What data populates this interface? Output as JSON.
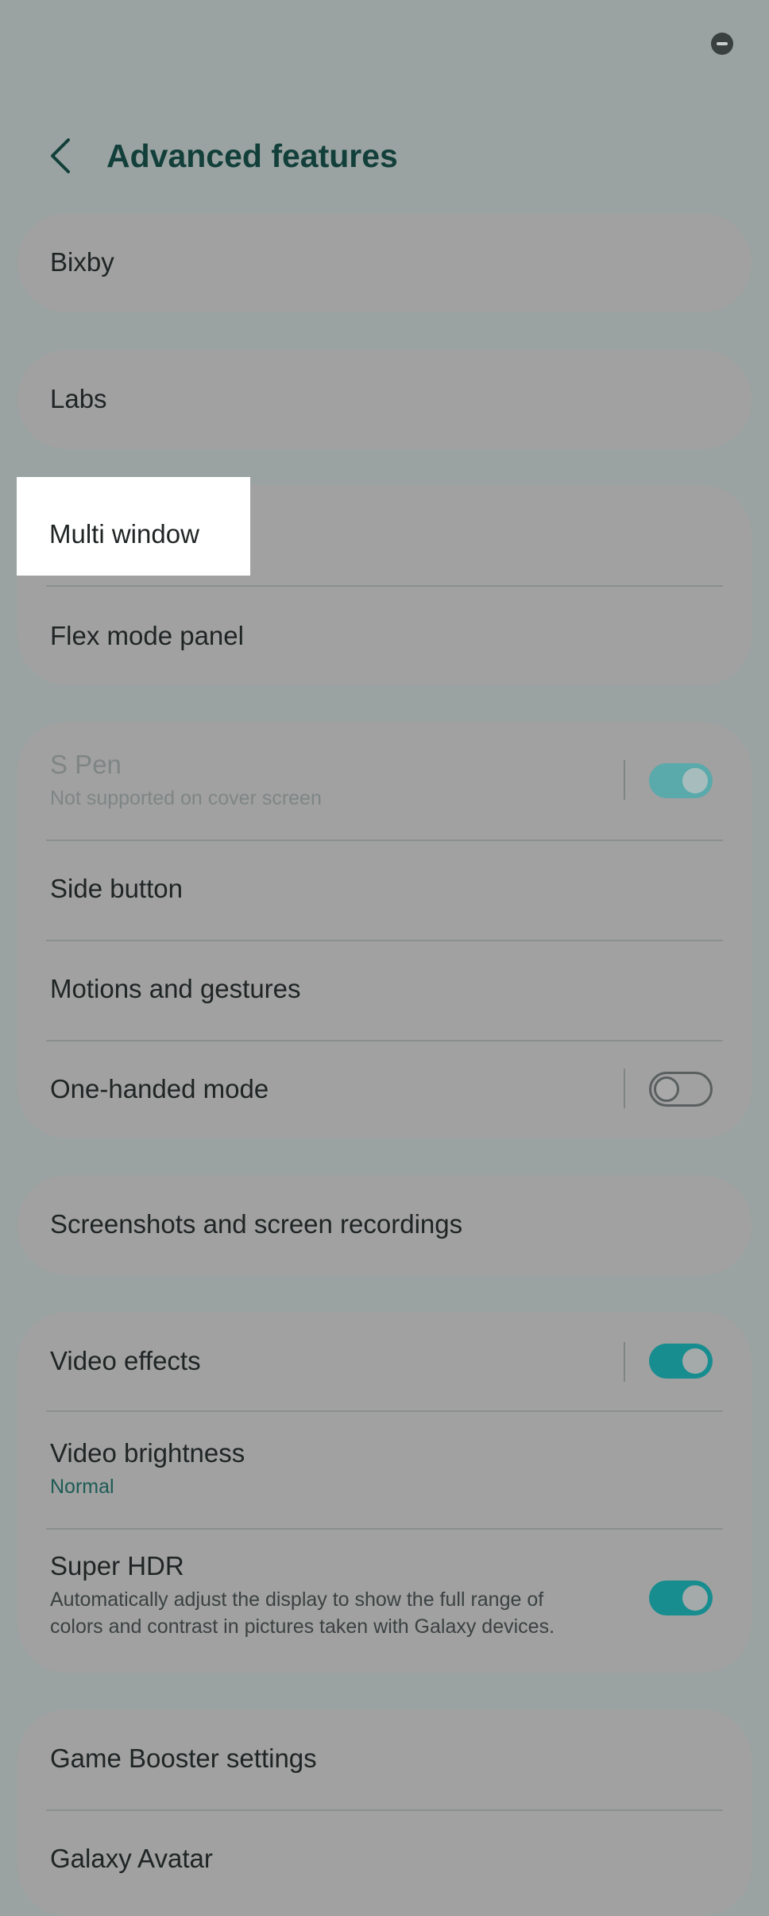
{
  "header": {
    "title": "Advanced features"
  },
  "items": {
    "bixby": "Bixby",
    "labs": "Labs",
    "multi_window": "Multi window",
    "flex_mode_panel": "Flex mode panel",
    "s_pen": "S Pen",
    "s_pen_sub": "Not supported on cover screen",
    "side_button": "Side button",
    "motions_gestures": "Motions and gestures",
    "one_handed_mode": "One-handed mode",
    "screenshots": "Screenshots and screen recordings",
    "video_effects": "Video effects",
    "video_brightness": "Video brightness",
    "video_brightness_value": "Normal",
    "super_hdr": "Super HDR",
    "super_hdr_sub_line1": "Automatically adjust the display to show the full range of",
    "super_hdr_sub_line2": "colors and contrast in pictures taken with Galaxy devices.",
    "game_booster": "Game Booster settings",
    "galaxy_avatar": "Galaxy Avatar"
  },
  "toggles": {
    "s_pen": "on (disabled)",
    "one_handed_mode": "off",
    "video_effects": "on",
    "super_hdr": "on"
  },
  "colors": {
    "title": "#123f3a",
    "toggle_on": "#178d90",
    "accent_text": "#1d5b55"
  },
  "icons": {
    "back": "chevron-left-icon",
    "status": "minus-circle-icon"
  }
}
